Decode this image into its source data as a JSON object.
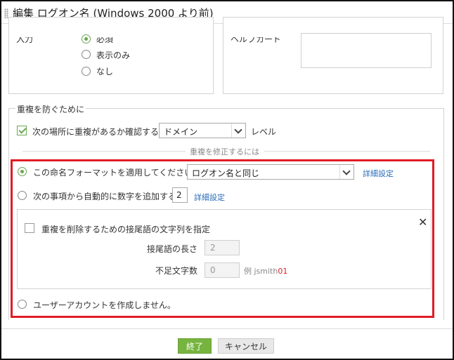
{
  "dialog": {
    "title": "編集 ログオン名 (Windows 2000 より前)"
  },
  "top_section": {
    "left_label_partial": "入力",
    "options": [
      {
        "label": "必須",
        "checked": true
      },
      {
        "label": "表示のみ",
        "checked": false
      },
      {
        "label": "なし",
        "checked": false
      }
    ],
    "right_label_partial": "ヘルプカード"
  },
  "dup_section": {
    "title": "重複を防ぐために",
    "check_label": "次の場所に重複があるか確認する:",
    "check_checked": true,
    "scope_value": "ドメイン",
    "level_suffix": "レベル",
    "fix_divider": "重複を修正するには",
    "option1_label": "この命名フォーマットを適用してください",
    "option1_select": "ログオン名と同じ",
    "option1_link": "詳細設定",
    "option2_label": "次の事項から自動的に数字を追加する:",
    "option2_value": "2",
    "option2_link": "詳細設定",
    "suffix_check_label": "重複を削除するための接尾語の文字列を指定",
    "suffix_length_label": "接尾語の長さ",
    "suffix_length_value": "2",
    "missing_chars_label": "不足文字数",
    "missing_chars_value": "0",
    "example_prefix": "例",
    "example_name": "jsmith",
    "example_digits": "01",
    "option3_label": "ユーザーアカウントを作成しません。"
  },
  "footer": {
    "finish_label": "終了",
    "cancel_label": "キャンセル"
  },
  "colors": {
    "accent_green": "#76b43f",
    "highlight_red": "#e01c24",
    "link_blue": "#2a6ebb"
  }
}
